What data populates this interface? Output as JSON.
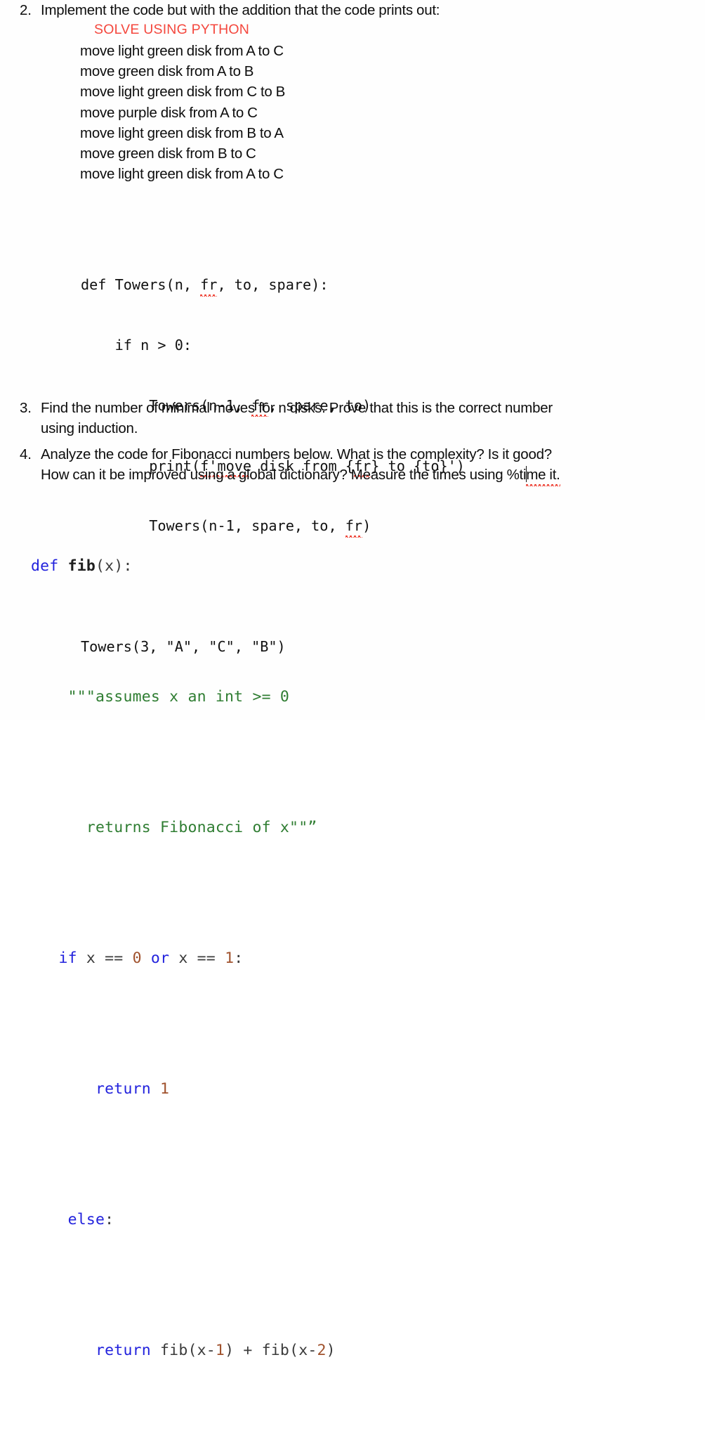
{
  "document": {
    "colors": {
      "background": "#fefefe",
      "text": "#0d0d0d",
      "annotation_red": "#f4473d",
      "keyword_blue": "#2222dd",
      "string_green": "#2f7d32",
      "number_orange": "#a0522d",
      "function_black": "#1f1f1f",
      "spellcheck_red": "#ea1c0d"
    },
    "items": [
      {
        "number": "2.",
        "text": "Implement the code but with the addition that the code prints out:"
      },
      {
        "number": "3.",
        "line1": "Find the number of minimal moves for n disks. Prove that this is the correct number",
        "line2": "using induction."
      },
      {
        "number": "4.",
        "line1": "Analyze the code for Fibonacci numbers below. What is the complexity? Is it good?",
        "line2_a": "How can it be improved using a global dictionary? Measure the times using %ti",
        "line2_b": "me it."
      }
    ],
    "annotation": {
      "solve_note": "SOLVE USING PYTHON"
    },
    "moves": [
      "move light green disk from A to C",
      "move green disk from A to B",
      "move light green disk from C to B",
      "move purple disk from A to C",
      "move light green disk from B to A",
      "move green disk from B to C",
      "move light green disk from A to C"
    ],
    "towers_code": {
      "line1_a": "def Towers(n, ",
      "line1_sq": "fr",
      "line1_b": ", to, spare):",
      "line2": "    if n > 0:",
      "line3_a": "        Towers(n-1, ",
      "line3_sq": "fr",
      "line3_b": ", spare, to)",
      "line4_a": "        print(",
      "line4_sq1": "f'move",
      "line4_b": " disk from {",
      "line4_sq2": "fr",
      "line4_c": "} to {to}')",
      "line5_a": "        Towers(n-1, spare, to, ",
      "line5_sq": "fr",
      "line5_b": ")",
      "line6": "",
      "line7": "Towers(3, \"A\", \"C\", \"B\")"
    },
    "fib_code": {
      "l1_kw": "def",
      "l1_sp": " ",
      "l1_fn": "fib",
      "l1_rest": "(x):",
      "l2_indent": "    ",
      "l2_str": "\"\"\"assumes x an int >= 0",
      "l3_indent": "      ",
      "l3_str": "returns Fibonacci of x\"\"”",
      "l4_indent": "   ",
      "l4_kw1": "if",
      "l4_a": " x == ",
      "l4_n1": "0",
      "l4_b": " ",
      "l4_kw2": "or",
      "l4_c": " x == ",
      "l4_n2": "1",
      "l4_d": ":",
      "l5_indent": "       ",
      "l5_kw": "return",
      "l5_sp": " ",
      "l5_n": "1",
      "l6_indent": "    ",
      "l6_kw": "else",
      "l6_rest": ":",
      "l7_indent": "       ",
      "l7_kw": "return",
      "l7_a": " fib(x-",
      "l7_n1": "1",
      "l7_b": ") + fib(x-",
      "l7_n2": "2",
      "l7_c": ")"
    }
  }
}
